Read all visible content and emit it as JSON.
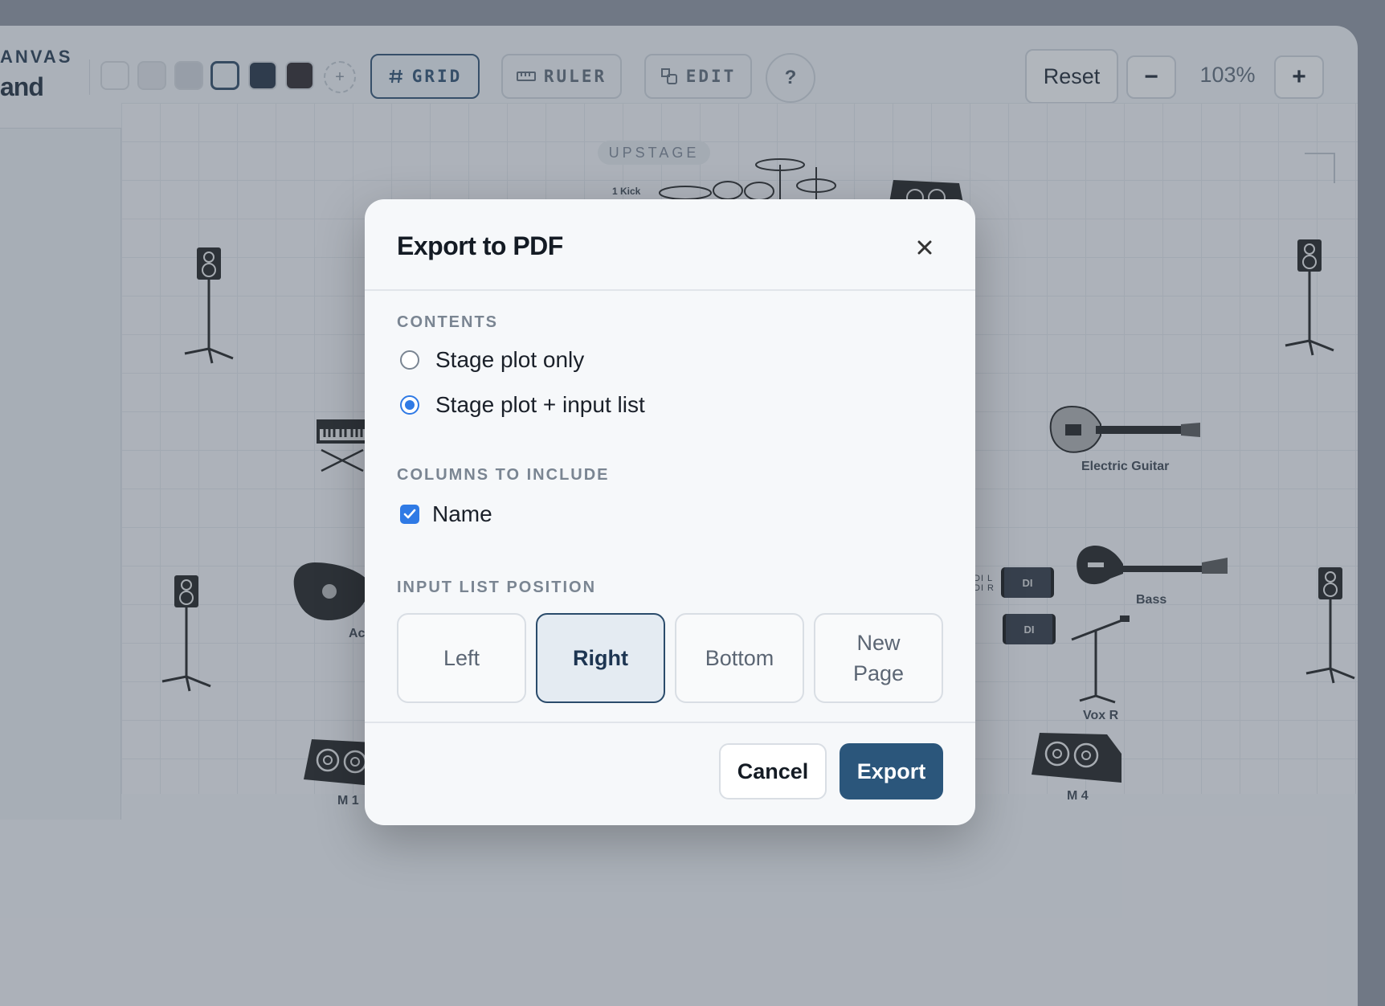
{
  "toolbar": {
    "brand_line1": "ANVAS",
    "brand_line2": "and",
    "swatches": [
      "#f5f7fa",
      "#e3e6ea",
      "#d2d6dc",
      "#f0f3f6",
      "#1f2e40",
      "#2a2326"
    ],
    "selected_swatch": 3,
    "add_swatch": "+",
    "grid_label": "GRID",
    "ruler_label": "RULER",
    "edit_label": "EDIT",
    "help_label": "?",
    "reset_label": "Reset",
    "zoom_out_label": "−",
    "zoom_level": "103%",
    "zoom_in_label": "+"
  },
  "canvas": {
    "upstage_label": "UPSTAGE",
    "kick_label": "1 Kick",
    "di_label": "DI",
    "labels": {
      "electric_guitar": "Electric Guitar",
      "bass": "Bass",
      "vox_r": "Vox R",
      "m1": "M 1",
      "m4": "M 4",
      "acoustic": "Ac",
      "di_l": "DI L",
      "di_r": "DI R"
    }
  },
  "modal": {
    "title": "Export to PDF",
    "close_icon": "close-icon",
    "contents_heading": "CONTENTS",
    "contents_options": [
      {
        "label": "Stage plot only",
        "selected": false
      },
      {
        "label": "Stage plot + input list",
        "selected": true
      }
    ],
    "columns_heading": "COLUMNS TO INCLUDE",
    "columns": [
      {
        "label": "Name",
        "checked": true
      }
    ],
    "position_heading": "INPUT LIST POSITION",
    "positions": [
      {
        "label": "Left",
        "selected": false
      },
      {
        "label": "Right",
        "selected": true
      },
      {
        "label": "Bottom",
        "selected": false
      },
      {
        "label": "New Page",
        "selected": false
      }
    ],
    "cancel_label": "Cancel",
    "export_label": "Export"
  },
  "colors": {
    "accent": "#2f7ae5",
    "primary_button": "#2b567b",
    "selected_border": "#2a4b6b"
  }
}
